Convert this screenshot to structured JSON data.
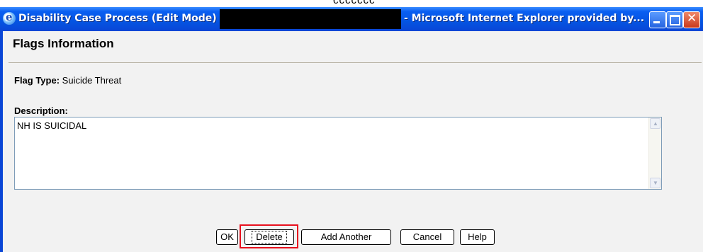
{
  "window": {
    "title_left": "Disability Case Process (Edit Mode)",
    "title_right": "- Microsoft Internet Explorer provided by...",
    "controls": {
      "minimize": "minimize-icon",
      "maximize": "maximize-icon",
      "close": "close-icon"
    }
  },
  "panel": {
    "header": "Flags Information",
    "flag_type_label": "Flag Type:",
    "flag_type_value": "Suicide Threat",
    "description_label": "Description:",
    "description_value": "NH IS SUICIDAL"
  },
  "buttons": {
    "ok": "OK",
    "delete": "Delete",
    "add_another": "Add Another",
    "cancel": "Cancel",
    "help": "Help"
  },
  "highlight": {
    "target": "delete",
    "color": "#e8101d"
  },
  "colors": {
    "titlebar": "#0a46d6",
    "client": "#f2f2f2"
  }
}
